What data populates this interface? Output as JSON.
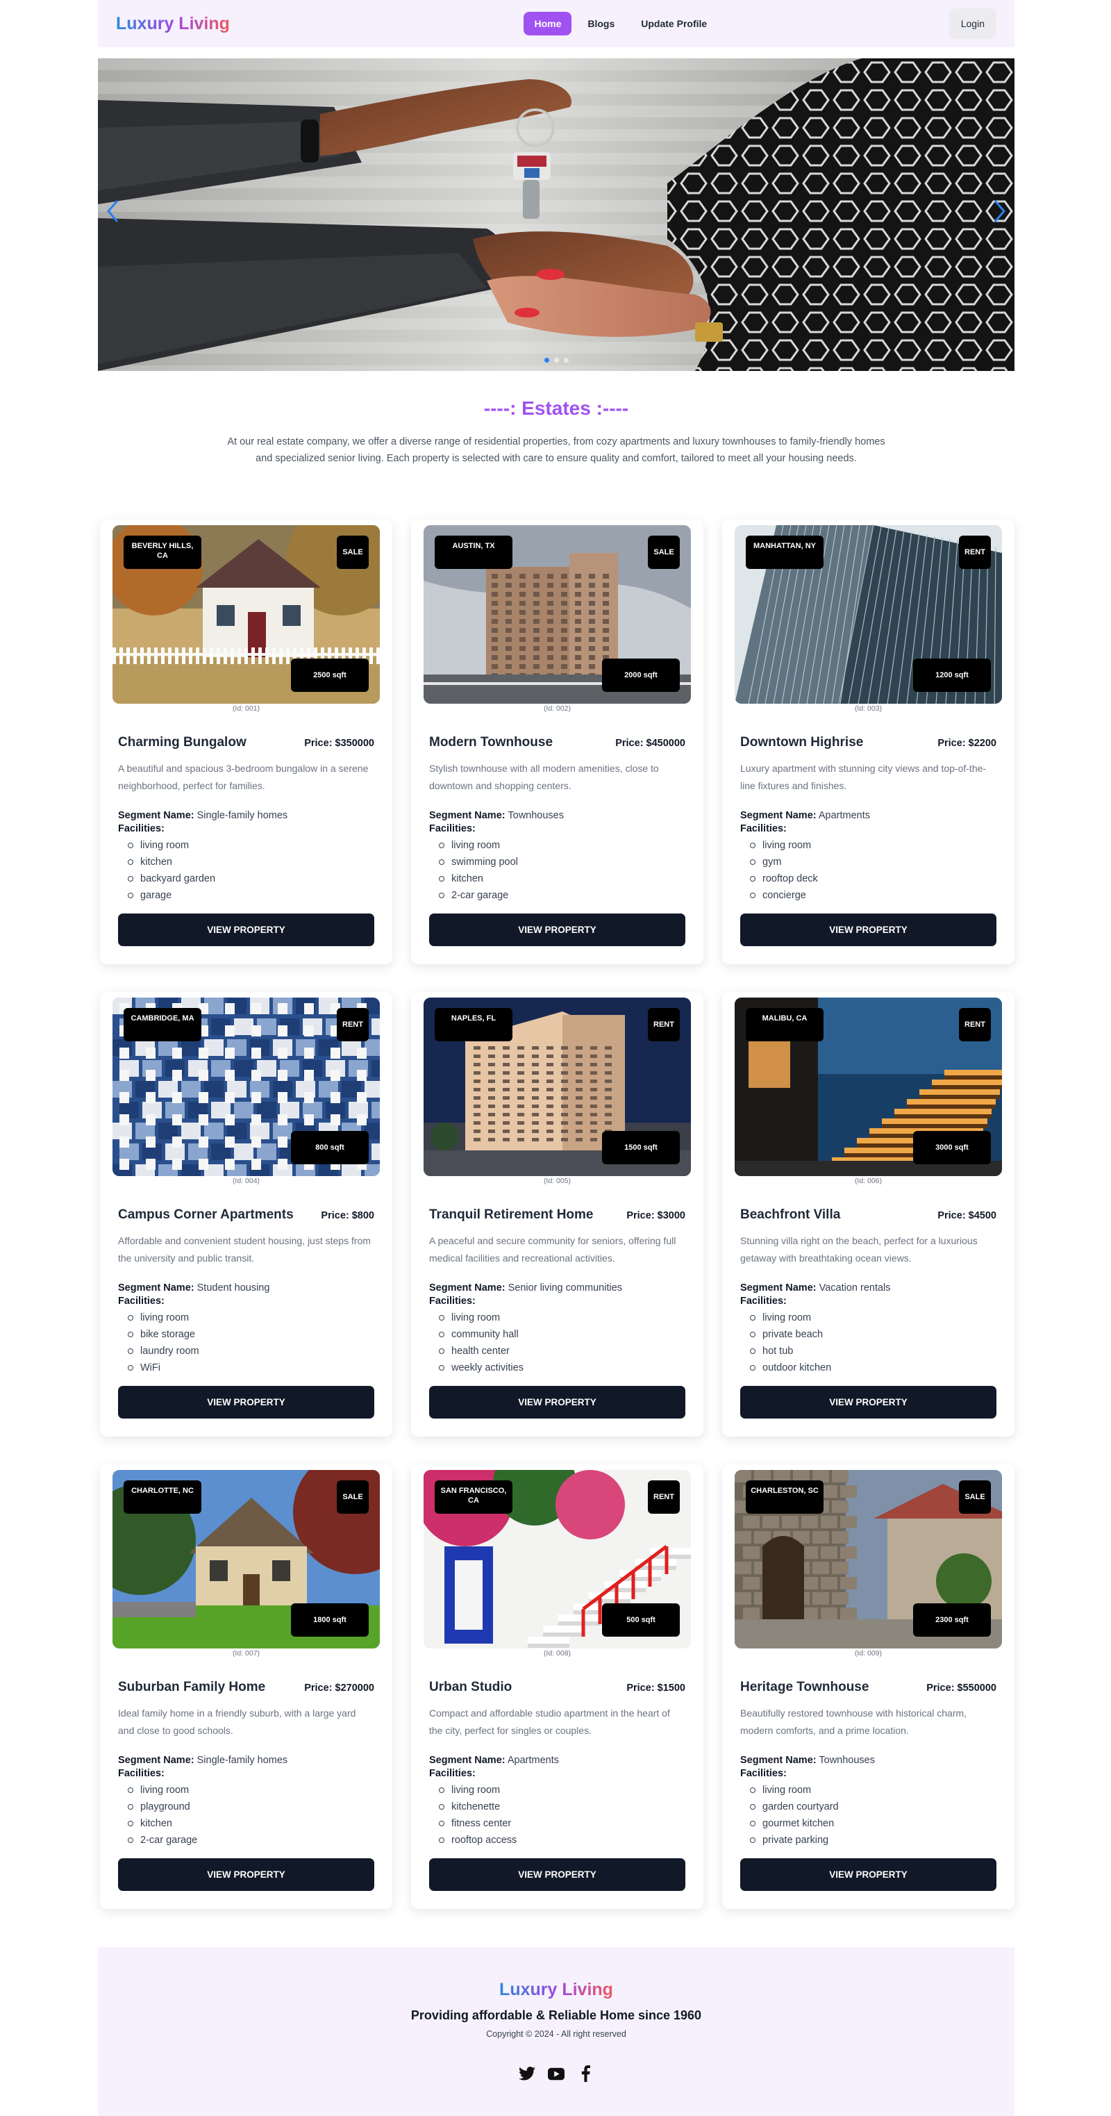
{
  "nav": {
    "brand": "Luxury Living",
    "links": [
      "Home",
      "Blogs",
      "Update Profile"
    ],
    "login_label": "Login"
  },
  "hero": {
    "slide_count": 3,
    "active_slide": 1
  },
  "section": {
    "title": "----: Estates :----",
    "description": "At our real estate company, we offer a diverse range of residential properties, from cozy apartments and luxury townhouses to family-friendly homes and specialized senior living. Each property is selected with care to ensure quality and comfort, tailored to meet all your housing needs."
  },
  "labels": {
    "segment": "Segment Name:",
    "facilities": "Facilities:",
    "view_button": "VIEW PROPERTY"
  },
  "properties": [
    {
      "location": "BEVERLY HILLS, CA",
      "deal": "SALE",
      "area": "2500 sqft",
      "id": "(Id: 001)",
      "title": "Charming Bungalow",
      "price": "Price: $350000",
      "description": "A beautiful and spacious 3-bedroom bungalow in a serene neighborhood, perfect for families.",
      "segment": "Single-family homes",
      "facilities": [
        "living room",
        "kitchen",
        "backyard garden",
        "garage"
      ],
      "scene": "bungalow"
    },
    {
      "location": "AUSTIN, TX",
      "deal": "SALE",
      "area": "2000 sqft",
      "id": "(Id: 002)",
      "title": "Modern Townhouse",
      "price": "Price: $450000",
      "description": "Stylish townhouse with all modern amenities, close to downtown and shopping centers.",
      "segment": "Townhouses",
      "facilities": [
        "living room",
        "swimming pool",
        "kitchen",
        "2-car garage"
      ],
      "scene": "brick"
    },
    {
      "location": "MANHATTAN, NY",
      "deal": "RENT",
      "area": "1200 sqft",
      "id": "(Id: 003)",
      "title": "Downtown Highrise",
      "price": "Price: $2200",
      "description": "Luxury apartment with stunning city views and top-of-the-line fixtures and finishes.",
      "segment": "Apartments",
      "facilities": [
        "living room",
        "gym",
        "rooftop deck",
        "concierge"
      ],
      "scene": "glass"
    },
    {
      "location": "CAMBRIDGE, MA",
      "deal": "RENT",
      "area": "800 sqft",
      "id": "(Id: 004)",
      "title": "Campus Corner Apartments",
      "price": "Price: $800",
      "description": "Affordable and convenient student housing, just steps from the university and public transit.",
      "segment": "Student housing",
      "facilities": [
        "living room",
        "bike storage",
        "laundry room",
        "WiFi"
      ],
      "scene": "tiles"
    },
    {
      "location": "NAPLES, FL",
      "deal": "RENT",
      "area": "1500 sqft",
      "id": "(Id: 005)",
      "title": "Tranquil Retirement Home",
      "price": "Price: $3000",
      "description": "A peaceful and secure community for seniors, offering full medical facilities and recreational activities.",
      "segment": "Senior living communities",
      "facilities": [
        "living room",
        "community hall",
        "health center",
        "weekly activities"
      ],
      "scene": "tower"
    },
    {
      "location": "MALIBU, CA",
      "deal": "RENT",
      "area": "3000 sqft",
      "id": "(Id: 006)",
      "title": "Beachfront Villa",
      "price": "Price: $4500",
      "description": "Stunning villa right on the beach, perfect for a luxurious getaway with breathtaking ocean views.",
      "segment": "Vacation rentals",
      "facilities": [
        "living room",
        "private beach",
        "hot tub",
        "outdoor kitchen"
      ],
      "scene": "villa"
    },
    {
      "location": "CHARLOTTE, NC",
      "deal": "SALE",
      "area": "1800 sqft",
      "id": "(Id: 007)",
      "title": "Suburban Family Home",
      "price": "Price: $270000",
      "description": "Ideal family home in a friendly suburb, with a large yard and close to good schools.",
      "segment": "Single-family homes",
      "facilities": [
        "living room",
        "playground",
        "kitchen",
        "2-car garage"
      ],
      "scene": "house"
    },
    {
      "location": "SAN FRANCISCO, CA",
      "deal": "RENT",
      "area": "500 sqft",
      "id": "(Id: 008)",
      "title": "Urban Studio",
      "price": "Price: $1500",
      "description": "Compact and affordable studio apartment in the heart of the city, perfect for singles or couples.",
      "segment": "Apartments",
      "facilities": [
        "living room",
        "kitchenette",
        "fitness center",
        "rooftop access"
      ],
      "scene": "studio"
    },
    {
      "location": "CHARLESTON, SC",
      "deal": "SALE",
      "area": "2300 sqft",
      "id": "(Id: 009)",
      "title": "Heritage Townhouse",
      "price": "Price: $550000",
      "description": "Beautifully restored townhouse with historical charm, modern comforts, and a prime location.",
      "segment": "Townhouses",
      "facilities": [
        "living room",
        "garden courtyard",
        "gourmet kitchen",
        "private parking"
      ],
      "scene": "stone"
    }
  ],
  "footer": {
    "brand": "Luxury Living",
    "tagline": "Providing affordable & Reliable Home since 1960",
    "copyright": "Copyright © 2024 - All right reserved",
    "socials": [
      "twitter-icon",
      "youtube-icon",
      "facebook-icon"
    ]
  },
  "colors": {
    "accent": "#a052f0",
    "nav_bg": "#f7f1fd",
    "button_dark": "#111827",
    "carousel_active": "#2a7ff0"
  }
}
